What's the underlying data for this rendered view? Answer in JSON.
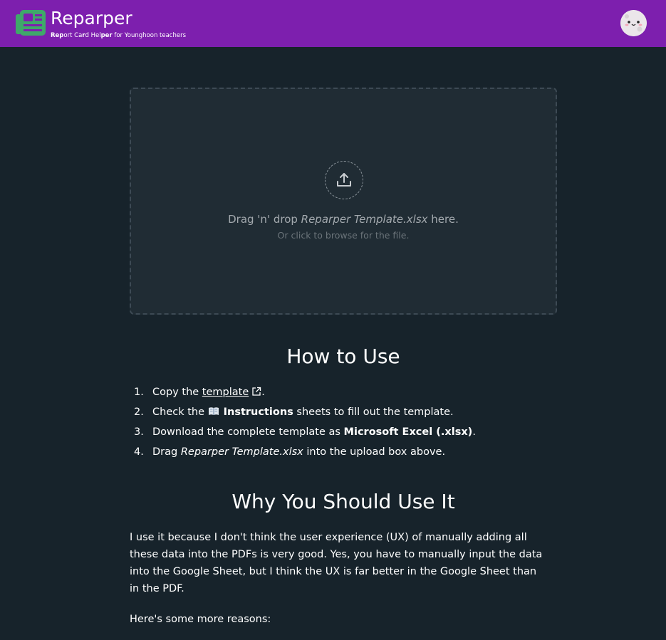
{
  "header": {
    "brand": "Reparper",
    "subtitle_parts": [
      {
        "text": "Rep",
        "bold": true
      },
      {
        "text": "ort Ca",
        "bold": false
      },
      {
        "text": "r",
        "bold": true
      },
      {
        "text": "d Hel",
        "bold": false
      },
      {
        "text": "per",
        "bold": true
      },
      {
        "text": " for Younghoon teachers",
        "bold": false
      }
    ],
    "colors": {
      "bar": "#7d1fae",
      "logo": "#3fa86a"
    },
    "avatar_icon": "kawaii-face-avatar"
  },
  "dropzone": {
    "text_before": "Drag 'n' drop ",
    "filename": "Reparper Template.xlsx",
    "text_after": " here.",
    "sub": "Or click to browse for the file.",
    "icon": "upload-icon"
  },
  "how_to_use": {
    "title": "How to Use",
    "steps": [
      {
        "num": "1.",
        "a": "Copy the ",
        "link": "template",
        "b": "."
      },
      {
        "num": "2.",
        "a": "Check the ",
        "strong": "Instructions",
        "b": " sheets to fill out the template."
      },
      {
        "num": "3.",
        "a": "Download the complete template as ",
        "strong": "Microsoft Excel (.xlsx)",
        "b": "."
      },
      {
        "num": "4.",
        "a": "Drag ",
        "em": "Reparper Template.xlsx",
        "b": " into the upload box above."
      }
    ]
  },
  "why": {
    "title": "Why You Should Use It",
    "paragraph": "I use it because I don't think the user experience (UX) of manually adding all these data into the PDFs is very good. Yes, you have to manually input the data into the Google Sheet, but I think the UX is far better in the Google Sheet than in the PDF.",
    "reasons_intro": "Here's some more reasons:"
  }
}
